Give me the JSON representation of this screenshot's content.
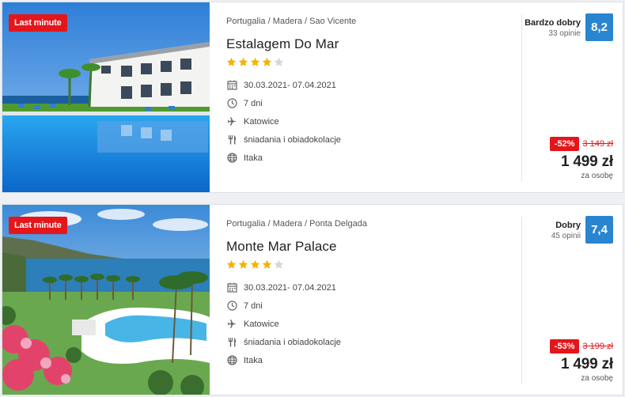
{
  "offers": [
    {
      "badge": "Last minute",
      "breadcrumb": "Portugalia / Madera / Sao Vicente",
      "name": "Estalagem Do Mar",
      "stars": 4,
      "stars_max": 5,
      "dates": "30.03.2021- 07.04.2021",
      "duration": "7 dni",
      "departure": "Katowice",
      "board": "śniadania i obiadokolacje",
      "operator": "Itaka",
      "rating_label": "Bardzo dobry",
      "reviews": "33 opinie",
      "score": "8,2",
      "discount": "-52%",
      "old_price": "3 149 zł",
      "price": "1 499 zł",
      "price_note": "za osobę"
    },
    {
      "badge": "Last minute",
      "breadcrumb": "Portugalia / Madera / Ponta Delgada",
      "name": "Monte Mar Palace",
      "stars": 4,
      "stars_max": 5,
      "dates": "30.03.2021- 07.04.2021",
      "duration": "7 dni",
      "departure": "Katowice",
      "board": "śniadania i obiadokolacje",
      "operator": "Itaka",
      "rating_label": "Dobry",
      "reviews": "45 opinii",
      "score": "7,4",
      "discount": "-53%",
      "old_price": "3 199 zł",
      "price": "1 499 zł",
      "price_note": "za osobę"
    }
  ],
  "colors": {
    "accent_red": "#e4161b",
    "score_blue": "#2a85d0",
    "star_gold": "#f5b400",
    "star_gray": "#d6d6d6"
  }
}
